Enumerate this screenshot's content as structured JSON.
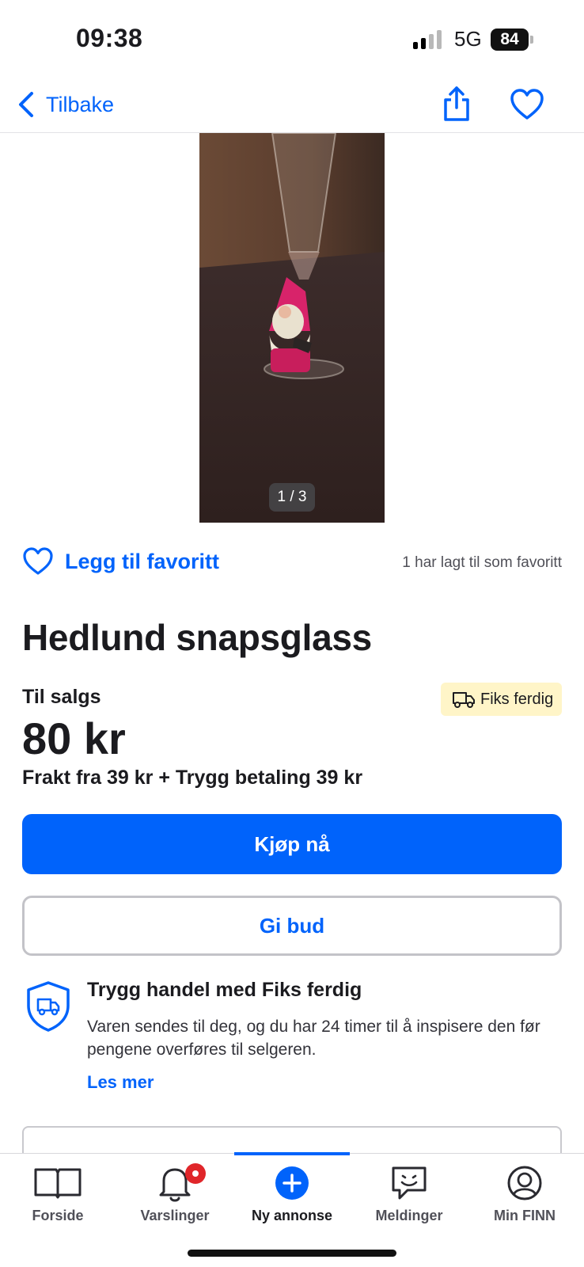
{
  "status_bar": {
    "time": "09:38",
    "network": "5G",
    "battery": "84"
  },
  "nav": {
    "back_label": "Tilbake"
  },
  "gallery": {
    "counter": "1 / 3"
  },
  "favorite": {
    "label": "Legg til favoritt",
    "count_text": "1 har lagt til som favoritt"
  },
  "listing": {
    "title": "Hedlund snapsglass",
    "status": "Til salgs",
    "badge": "Fiks ferdig",
    "price": "80 kr",
    "shipping": "Frakt fra 39 kr + Trygg betaling 39 kr",
    "buy_label": "Kjøp nå",
    "bid_label": "Gi bud"
  },
  "safe_trade": {
    "title": "Trygg handel med Fiks ferdig",
    "text": "Varen sendes til deg, og du har 24 timer til å inspisere den før pengene overføres til selgeren.",
    "link": "Les mer"
  },
  "tabs": [
    {
      "label": "Forside",
      "icon": "book-icon"
    },
    {
      "label": "Varslinger",
      "icon": "bell-icon"
    },
    {
      "label": "Ny annonse",
      "icon": "plus-circle-icon"
    },
    {
      "label": "Meldinger",
      "icon": "chat-icon"
    },
    {
      "label": "Min FINN",
      "icon": "profile-icon"
    }
  ],
  "colors": {
    "accent": "#0063fb",
    "badge_bg": "#fff5c8",
    "notification": "#e0262a"
  }
}
